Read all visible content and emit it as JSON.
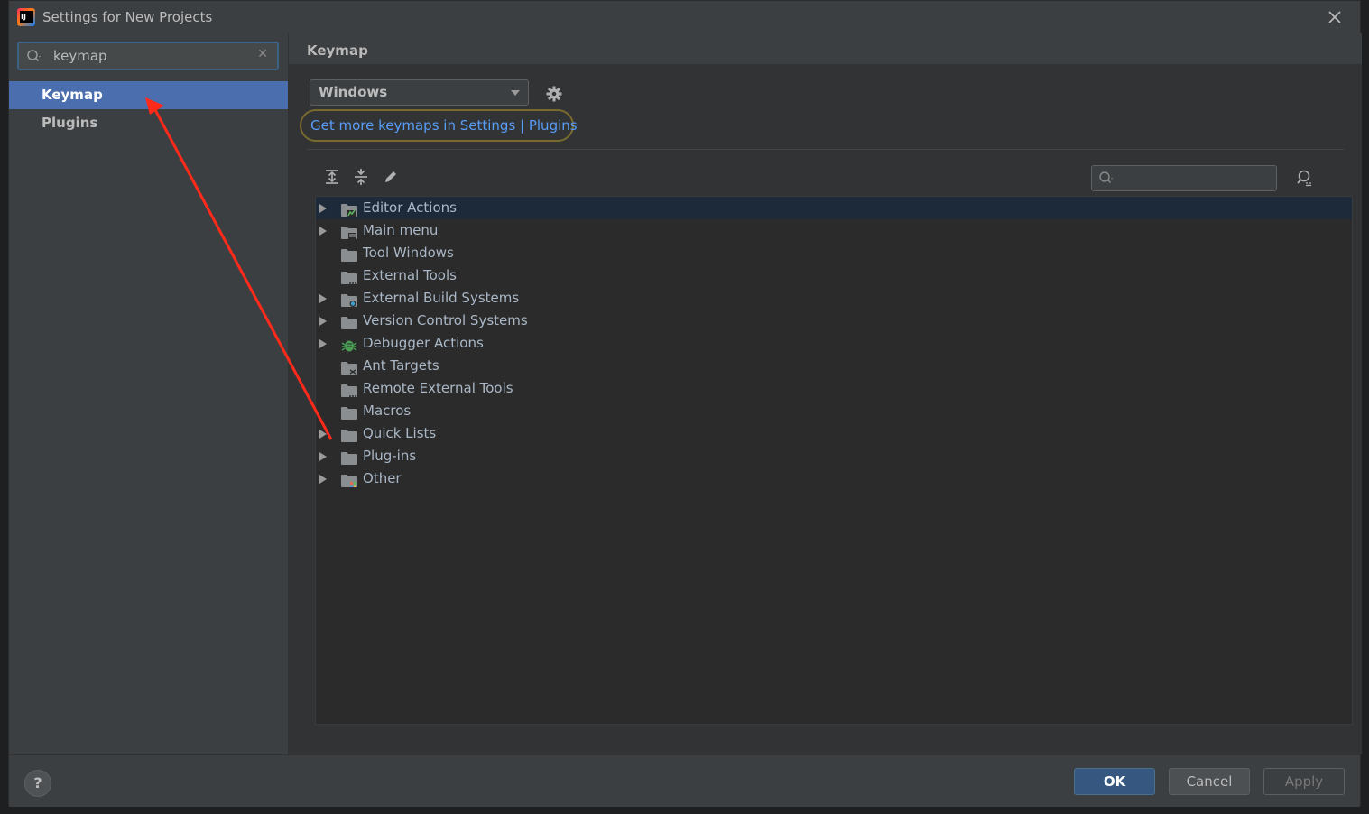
{
  "window": {
    "title": "Settings for New Projects"
  },
  "sidebar": {
    "search": {
      "value": "keymap"
    },
    "items": [
      {
        "label": "Keymap",
        "selected": true
      },
      {
        "label": "Plugins",
        "selected": false
      }
    ]
  },
  "main": {
    "title": "Keymap",
    "keymap_select": {
      "value": "Windows"
    },
    "link": "Get more keymaps in Settings | Plugins",
    "tree": [
      {
        "label": "Editor Actions",
        "expandable": true,
        "selected": true,
        "icon": "editor-actions-folder-icon"
      },
      {
        "label": "Main menu",
        "expandable": true,
        "icon": "menu-folder-icon"
      },
      {
        "label": "Tool Windows",
        "expandable": false,
        "icon": "folder-icon"
      },
      {
        "label": "External Tools",
        "expandable": false,
        "icon": "tools-folder-icon"
      },
      {
        "label": "External Build Systems",
        "expandable": true,
        "icon": "build-folder-icon"
      },
      {
        "label": "Version Control Systems",
        "expandable": true,
        "icon": "folder-icon"
      },
      {
        "label": "Debugger Actions",
        "expandable": true,
        "icon": "bug-icon"
      },
      {
        "label": "Ant Targets",
        "expandable": false,
        "icon": "ant-folder-icon"
      },
      {
        "label": "Remote External Tools",
        "expandable": false,
        "icon": "tools-folder-icon"
      },
      {
        "label": "Macros",
        "expandable": false,
        "icon": "folder-icon"
      },
      {
        "label": "Quick Lists",
        "expandable": true,
        "icon": "folder-icon"
      },
      {
        "label": "Plug-ins",
        "expandable": true,
        "icon": "folder-icon"
      },
      {
        "label": "Other",
        "expandable": true,
        "icon": "other-folder-icon"
      }
    ]
  },
  "footer": {
    "help": "?",
    "ok": "OK",
    "cancel": "Cancel",
    "apply": "Apply"
  },
  "colors": {
    "accent_selection": "#4b6eaf",
    "link": "#589df6",
    "annotation_arrow": "#ff2a1a",
    "link_highlight_ring": "#7a6a2e"
  }
}
